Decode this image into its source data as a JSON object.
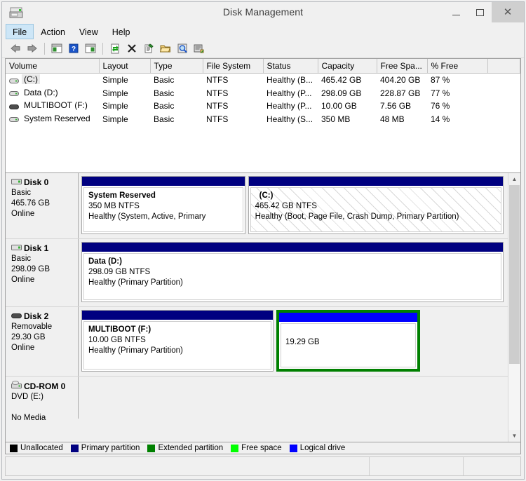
{
  "window": {
    "title": "Disk Management",
    "icon": "disk-drive-icon",
    "minimize_label": "Minimize",
    "maximize_label": "Maximize",
    "close_label": "Close"
  },
  "menubar": {
    "items": [
      {
        "label": "File",
        "active": true
      },
      {
        "label": "Action",
        "active": false
      },
      {
        "label": "View",
        "active": false
      },
      {
        "label": "Help",
        "active": false
      }
    ]
  },
  "toolbar": {
    "buttons": [
      {
        "name": "back-icon",
        "tip": "Back"
      },
      {
        "name": "forward-icon",
        "tip": "Forward"
      },
      {
        "name": "separator",
        "tip": ""
      },
      {
        "name": "show-hide-console-tree-icon",
        "tip": "Show/Hide Console Tree"
      },
      {
        "name": "help-icon",
        "tip": "Help"
      },
      {
        "name": "show-hide-action-pane-icon",
        "tip": "Show/Hide Action Pane"
      },
      {
        "name": "separator",
        "tip": ""
      },
      {
        "name": "refresh-icon",
        "tip": "Refresh"
      },
      {
        "name": "delete-icon",
        "tip": "Delete"
      },
      {
        "name": "properties-icon",
        "tip": "Properties"
      },
      {
        "name": "open-folder-icon",
        "tip": "Open"
      },
      {
        "name": "explore-search-icon",
        "tip": "Explore"
      },
      {
        "name": "rescan-disks-icon",
        "tip": "Rescan Disks"
      }
    ]
  },
  "volume_list": {
    "columns": [
      "Volume",
      "Layout",
      "Type",
      "File System",
      "Status",
      "Capacity",
      "Free Spa...",
      "% Free",
      ""
    ],
    "rows": [
      {
        "icon": "volume-icon",
        "volume": "(C:)",
        "layout": "Simple",
        "type": "Basic",
        "file_system": "NTFS",
        "status": "Healthy (B...",
        "capacity": "465.42 GB",
        "free_space": "404.20 GB",
        "percent_free": "87 %",
        "selected": true
      },
      {
        "icon": "volume-icon",
        "volume": "Data (D:)",
        "layout": "Simple",
        "type": "Basic",
        "file_system": "NTFS",
        "status": "Healthy (P...",
        "capacity": "298.09 GB",
        "free_space": "228.87 GB",
        "percent_free": "77 %",
        "selected": false
      },
      {
        "icon": "removable-volume-icon",
        "volume": "MULTIBOOT (F:)",
        "layout": "Simple",
        "type": "Basic",
        "file_system": "NTFS",
        "status": "Healthy (P...",
        "capacity": "10.00 GB",
        "free_space": "7.56 GB",
        "percent_free": "76 %",
        "selected": false
      },
      {
        "icon": "volume-icon",
        "volume": "System Reserved",
        "layout": "Simple",
        "type": "Basic",
        "file_system": "NTFS",
        "status": "Healthy (S...",
        "capacity": "350 MB",
        "free_space": "48 MB",
        "percent_free": "14 %",
        "selected": false
      }
    ]
  },
  "graphical_view": {
    "disks": [
      {
        "name": "Disk 0",
        "icon": "disk-icon",
        "type": "Basic",
        "size": "465.76 GB",
        "state": "Online",
        "partitions": [
          {
            "name": "System Reserved",
            "size_fs": "350 MB NTFS",
            "status": "Healthy (System, Active, Primary",
            "bar_color": "#000080",
            "selected": false,
            "hatched": false,
            "flex": 39
          },
          {
            "name": "(C:)",
            "size_fs": "465.42 GB NTFS",
            "status": "Healthy (Boot, Page File, Crash Dump, Primary Partition)",
            "bar_color": "#000080",
            "selected": false,
            "hatched": true,
            "flex": 61
          }
        ]
      },
      {
        "name": "Disk 1",
        "icon": "disk-icon",
        "type": "Basic",
        "size": "298.09 GB",
        "state": "Online",
        "partitions": [
          {
            "name": "Data  (D:)",
            "size_fs": "298.09 GB NTFS",
            "status": "Healthy (Primary Partition)",
            "bar_color": "#000080",
            "selected": false,
            "hatched": false,
            "flex": 100
          }
        ]
      },
      {
        "name": "Disk 2",
        "icon": "removable-disk-icon",
        "type": "Removable",
        "size": "29.30 GB",
        "state": "Online",
        "partitions": [
          {
            "name": "MULTIBOOT  (F:)",
            "size_fs": "10.00 GB NTFS",
            "status": "Healthy (Primary Partition)",
            "bar_color": "#000080",
            "selected": false,
            "hatched": false,
            "flex": 58
          },
          {
            "name": "",
            "size_fs": "19.29 GB",
            "status": "",
            "bar_color": "#0000ff",
            "selected": true,
            "hatched": false,
            "flex": 42
          }
        ]
      },
      {
        "name": "CD-ROM 0",
        "icon": "cdrom-icon",
        "type": "DVD (E:)",
        "size": "",
        "state": "No Media",
        "partitions": []
      }
    ],
    "scrollbar": {
      "up_arrow": "▲",
      "down_arrow": "▼"
    }
  },
  "legend": {
    "items": [
      {
        "label": "Unallocated",
        "color": "#000000"
      },
      {
        "label": "Primary partition",
        "color": "#000080"
      },
      {
        "label": "Extended partition",
        "color": "#008000"
      },
      {
        "label": "Free space",
        "color": "#00ff00"
      },
      {
        "label": "Logical drive",
        "color": "#0000ff"
      }
    ]
  },
  "statusbar": {
    "cells": [
      "",
      "",
      ""
    ]
  }
}
